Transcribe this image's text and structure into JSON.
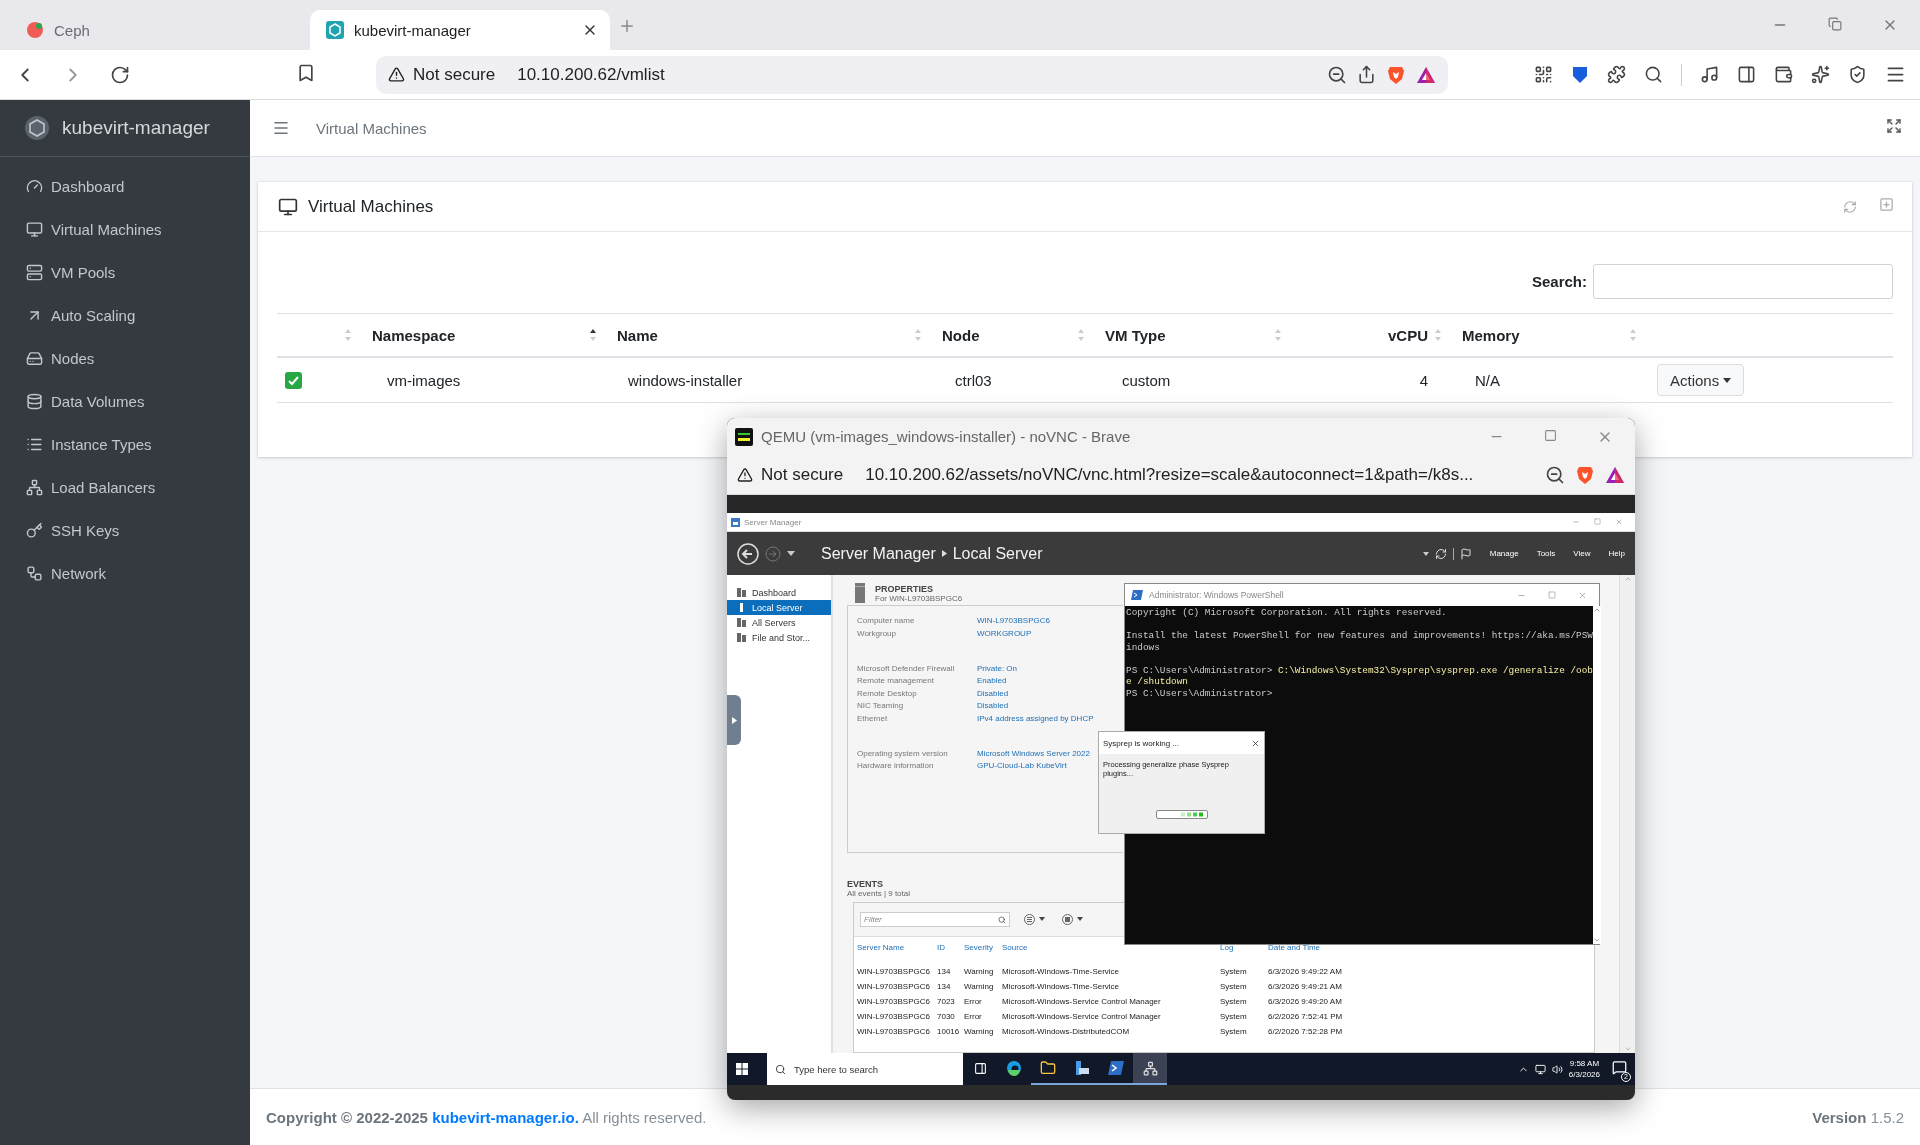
{
  "browser": {
    "tabs": [
      {
        "title": "Ceph",
        "selected": false
      },
      {
        "title": "kubevirt-manager",
        "selected": true
      }
    ],
    "security": "Not secure",
    "url": "10.10.200.62/vmlist"
  },
  "sidebar": {
    "brand": "kubevirt-manager",
    "items": [
      {
        "label": "Dashboard"
      },
      {
        "label": "Virtual Machines"
      },
      {
        "label": "VM Pools"
      },
      {
        "label": "Auto Scaling"
      },
      {
        "label": "Nodes"
      },
      {
        "label": "Data Volumes"
      },
      {
        "label": "Instance Types"
      },
      {
        "label": "Load Balancers"
      },
      {
        "label": "SSH Keys"
      },
      {
        "label": "Network"
      }
    ]
  },
  "header": {
    "breadcrumb": "Virtual Machines"
  },
  "card": {
    "title": "Virtual Machines",
    "search_label": "Search:",
    "columns": [
      {
        "sorted_ascending": false
      },
      {
        "label": "Namespace",
        "sorted_ascending": true
      },
      {
        "label": "Name",
        "sorted_ascending": false
      },
      {
        "label": "Node",
        "sorted_ascending": false
      },
      {
        "label": "VM Type",
        "sorted_ascending": false
      },
      {
        "label": "vCPU",
        "sorted_ascending": false
      },
      {
        "label": "Memory",
        "sorted_ascending": false
      }
    ],
    "rows": [
      {
        "status_ok": true,
        "namespace": "vm-images",
        "name": "windows-installer",
        "node": "ctrl03",
        "vm_type": "custom",
        "vcpu": "4",
        "memory": "N/A",
        "action": "Actions"
      }
    ]
  },
  "footer": {
    "copyright": "Copyright © 2022-2025",
    "link": "kubevirt-manager.io.",
    "rights": "All rights reserved.",
    "version_label": "Version",
    "version": "1.5.2"
  },
  "vnc_window": {
    "title": "QEMU (vm-images_windows-installer) - noVNC - Brave",
    "security": "Not secure",
    "url": "10.10.200.62/assets/noVNC/vnc.html?resize=scale&autoconnect=1&path=/k8s...",
    "server_manager": {
      "app_title": "Server Manager",
      "breadcrumb": [
        "Server Manager",
        "Local Server"
      ],
      "menu": [
        "Manage",
        "Tools",
        "View",
        "Help"
      ],
      "nav": [
        {
          "label": "Dashboard",
          "selected": false
        },
        {
          "label": "Local Server",
          "selected": true
        },
        {
          "label": "All Servers",
          "selected": false
        },
        {
          "label": "File and Stor...",
          "selected": false
        }
      ],
      "properties": {
        "heading": "PROPERTIES",
        "subheading": "For WIN-L9703BSPGC6",
        "groups": [
          [
            {
              "label": "Computer name",
              "value": "WIN-L9703BSPGC6"
            },
            {
              "label": "Workgroup",
              "value": "WORKGROUP"
            }
          ],
          [
            {
              "label": "Microsoft Defender Firewall",
              "value": "Private: On"
            },
            {
              "label": "Remote management",
              "value": "Enabled"
            },
            {
              "label": "Remote Desktop",
              "value": "Disabled"
            },
            {
              "label": "NIC Teaming",
              "value": "Disabled"
            },
            {
              "label": "Ethernet",
              "value": "IPv4 address assigned by DHCP"
            }
          ],
          [
            {
              "label": "Operating system version",
              "value": "Microsoft Windows Server 2022"
            },
            {
              "label": "Hardware information",
              "value": "GPU-Cloud-Lab KubeVirt"
            }
          ]
        ]
      },
      "events": {
        "heading": "EVENTS",
        "summary": "All events | 9 total",
        "filter_placeholder": "Filter",
        "columns": [
          "Server Name",
          "ID",
          "Severity",
          "Source",
          "Log",
          "Date and Time"
        ],
        "rows": [
          [
            "WIN-L9703BSPGC6",
            "134",
            "Warning",
            "Microsoft-Windows-Time-Service",
            "System",
            "6/3/2026 9:49:22 AM"
          ],
          [
            "WIN-L9703BSPGC6",
            "134",
            "Warning",
            "Microsoft-Windows-Time-Service",
            "System",
            "6/3/2026 9:49:21 AM"
          ],
          [
            "WIN-L9703BSPGC6",
            "7023",
            "Error",
            "Microsoft-Windows-Service Control Manager",
            "System",
            "6/3/2026 9:49:20 AM"
          ],
          [
            "WIN-L9703BSPGC6",
            "7030",
            "Error",
            "Microsoft-Windows-Service Control Manager",
            "System",
            "6/2/2026 7:52:41 PM"
          ],
          [
            "WIN-L9703BSPGC6",
            "10016",
            "Warning",
            "Microsoft-Windows-DistributedCOM",
            "System",
            "6/2/2026 7:52:28 PM"
          ]
        ]
      }
    },
    "powershell": {
      "title": "Administrator: Windows PowerShell",
      "blocks": [
        [
          [
            {
              "kind": "plain",
              "text": "Copyright (C) Microsoft Corporation. All rights reserved."
            }
          ]
        ],
        [
          [
            {
              "kind": "plain",
              "text": "Install the latest PowerShell for new features and improvements! https://aka.ms/PSW"
            }
          ],
          [
            {
              "kind": "plain",
              "text": "indows"
            }
          ]
        ],
        [
          [
            {
              "kind": "plain",
              "text": "PS C:\\Users\\Administrator> "
            },
            {
              "kind": "command",
              "text": "C:\\Windows\\System32\\Sysprep\\sysprep.exe /generalize /oob"
            }
          ],
          [
            {
              "kind": "command",
              "text": "e /shutdown"
            }
          ],
          [
            {
              "kind": "plain",
              "text": "PS C:\\Users\\Administrator>"
            }
          ]
        ]
      ]
    },
    "sysprep": {
      "title": "Sysprep is working ...",
      "message": "Processing generalize phase Sysprep plugins..."
    },
    "taskbar": {
      "search_placeholder": "Type here to search",
      "time": "9:58 AM",
      "date": "6/3/2026",
      "notifications": "2"
    }
  }
}
